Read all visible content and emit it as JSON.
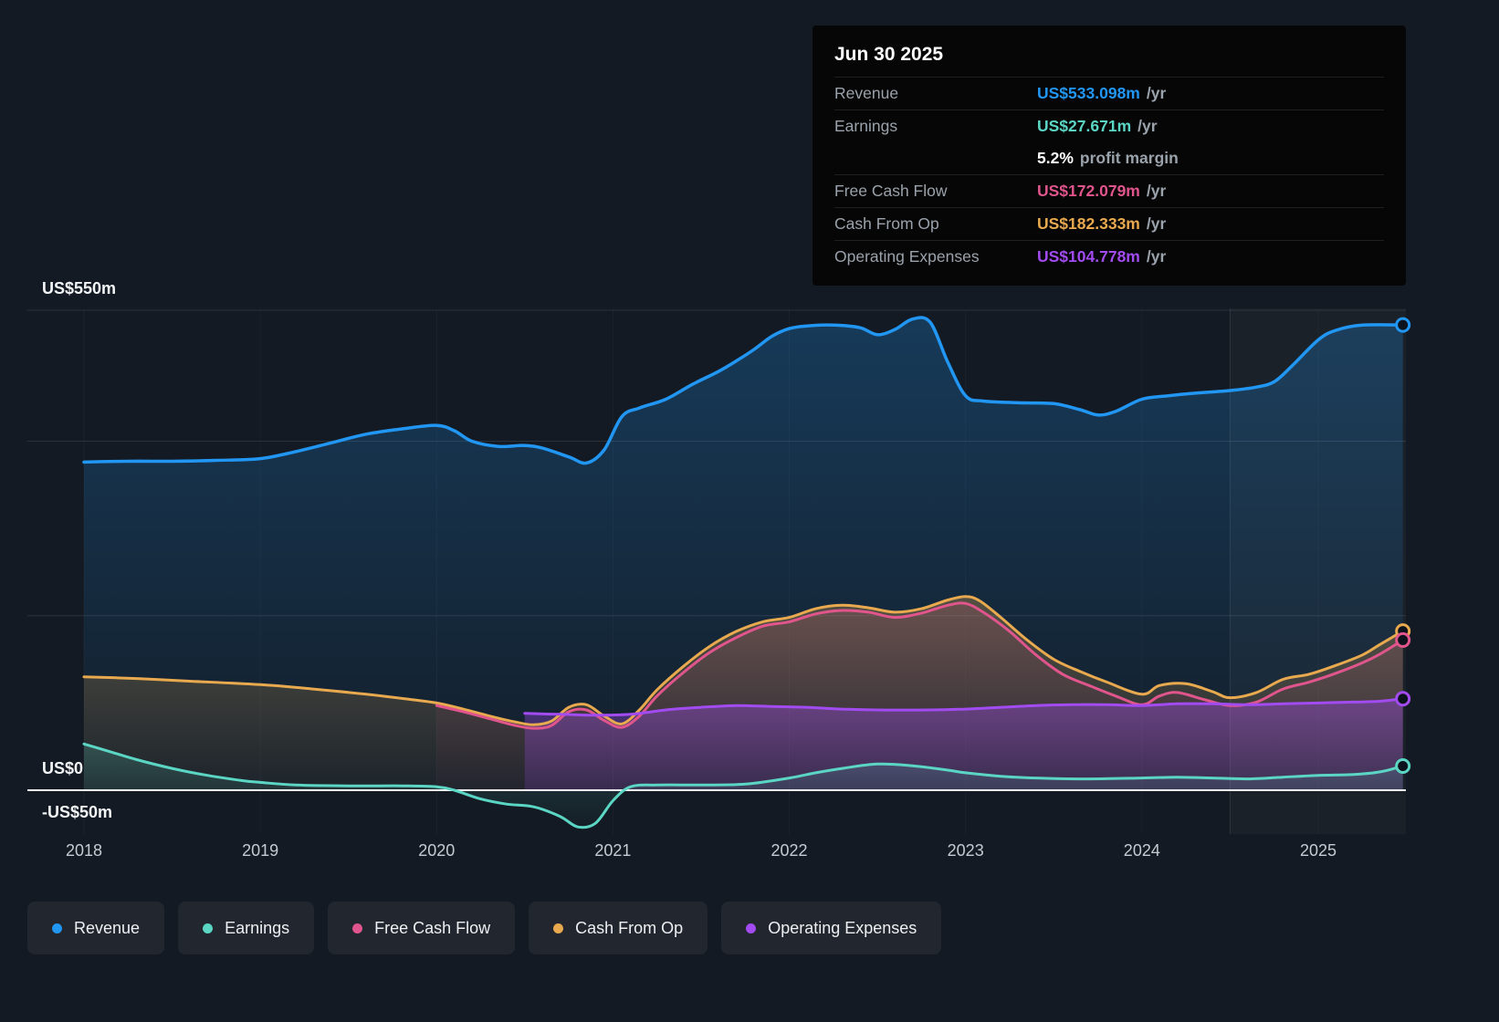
{
  "tooltip": {
    "date": "Jun 30 2025",
    "rows": [
      {
        "label": "Revenue",
        "value": "US$533.098m",
        "suffix": "/yr",
        "color": "#2196F3",
        "divider": true
      },
      {
        "label": "Earnings",
        "value": "US$27.671m",
        "suffix": "/yr",
        "color": "#5CD6C4",
        "divider": true
      },
      {
        "label": "",
        "value": "5.2%",
        "suffix": "profit margin",
        "color": "#FFFFFF",
        "divider": false
      },
      {
        "label": "Free Cash Flow",
        "value": "US$172.079m",
        "suffix": "/yr",
        "color": "#E0558C",
        "divider": true
      },
      {
        "label": "Cash From Op",
        "value": "US$182.333m",
        "suffix": "/yr",
        "color": "#E8A94F",
        "divider": true
      },
      {
        "label": "Operating Expenses",
        "value": "US$104.778m",
        "suffix": "/yr",
        "color": "#A24BF0",
        "divider": true
      }
    ]
  },
  "legend": [
    {
      "label": "Revenue",
      "color": "#2196F3"
    },
    {
      "label": "Earnings",
      "color": "#5CD6C4"
    },
    {
      "label": "Free Cash Flow",
      "color": "#E0558C"
    },
    {
      "label": "Cash From Op",
      "color": "#E8A94F"
    },
    {
      "label": "Operating Expenses",
      "color": "#A24BF0"
    }
  ],
  "chart_data": {
    "type": "area",
    "unit": "US$ millions per year",
    "x_ticks": [
      2018,
      2019,
      2020,
      2021,
      2022,
      2023,
      2024,
      2025
    ],
    "y_axis_labels": [
      {
        "value": 550,
        "text": "US$550m"
      },
      {
        "value": 0,
        "text": "US$0"
      },
      {
        "value": -50,
        "text": "-US$50m"
      }
    ],
    "gridline_values": [
      550,
      400,
      200
    ],
    "zero_line_value": 0,
    "ylim": [
      -50,
      550
    ],
    "xlim": [
      2017.68,
      2025.5
    ],
    "highlight_from": 2024.5,
    "series": [
      {
        "name": "Revenue",
        "color": "#2196F3",
        "points": [
          [
            2018.0,
            376
          ],
          [
            2018.25,
            377
          ],
          [
            2018.5,
            377
          ],
          [
            2018.75,
            378
          ],
          [
            2019.0,
            380
          ],
          [
            2019.2,
            388
          ],
          [
            2019.4,
            398
          ],
          [
            2019.6,
            408
          ],
          [
            2019.8,
            414
          ],
          [
            2020.0,
            418
          ],
          [
            2020.1,
            412
          ],
          [
            2020.2,
            400
          ],
          [
            2020.35,
            394
          ],
          [
            2020.5,
            395
          ],
          [
            2020.6,
            392
          ],
          [
            2020.75,
            382
          ],
          [
            2020.85,
            375
          ],
          [
            2020.95,
            390
          ],
          [
            2021.05,
            428
          ],
          [
            2021.15,
            438
          ],
          [
            2021.3,
            448
          ],
          [
            2021.45,
            465
          ],
          [
            2021.6,
            480
          ],
          [
            2021.7,
            492
          ],
          [
            2021.8,
            505
          ],
          [
            2021.9,
            520
          ],
          [
            2022.0,
            529
          ],
          [
            2022.1,
            532
          ],
          [
            2022.25,
            533
          ],
          [
            2022.4,
            530
          ],
          [
            2022.5,
            522
          ],
          [
            2022.6,
            528
          ],
          [
            2022.7,
            540
          ],
          [
            2022.8,
            536
          ],
          [
            2022.9,
            490
          ],
          [
            2023.0,
            452
          ],
          [
            2023.1,
            446
          ],
          [
            2023.3,
            444
          ],
          [
            2023.5,
            443
          ],
          [
            2023.65,
            436
          ],
          [
            2023.75,
            430
          ],
          [
            2023.85,
            434
          ],
          [
            2024.0,
            448
          ],
          [
            2024.15,
            452
          ],
          [
            2024.3,
            455
          ],
          [
            2024.5,
            458
          ],
          [
            2024.65,
            462
          ],
          [
            2024.75,
            468
          ],
          [
            2024.85,
            486
          ],
          [
            2025.0,
            516
          ],
          [
            2025.1,
            527
          ],
          [
            2025.25,
            533
          ],
          [
            2025.48,
            533.098
          ]
        ]
      },
      {
        "name": "Cash From Op",
        "color": "#E8A94F",
        "points": [
          [
            2018.0,
            130
          ],
          [
            2018.3,
            128
          ],
          [
            2018.6,
            125
          ],
          [
            2019.0,
            121
          ],
          [
            2019.3,
            116
          ],
          [
            2019.6,
            110
          ],
          [
            2019.85,
            104
          ],
          [
            2020.0,
            100
          ],
          [
            2020.15,
            93
          ],
          [
            2020.3,
            85
          ],
          [
            2020.45,
            78
          ],
          [
            2020.55,
            75
          ],
          [
            2020.65,
            79
          ],
          [
            2020.75,
            95
          ],
          [
            2020.85,
            98
          ],
          [
            2020.95,
            85
          ],
          [
            2021.05,
            76
          ],
          [
            2021.15,
            92
          ],
          [
            2021.25,
            115
          ],
          [
            2021.4,
            142
          ],
          [
            2021.55,
            165
          ],
          [
            2021.7,
            182
          ],
          [
            2021.85,
            193
          ],
          [
            2022.0,
            198
          ],
          [
            2022.15,
            208
          ],
          [
            2022.3,
            212
          ],
          [
            2022.45,
            209
          ],
          [
            2022.6,
            204
          ],
          [
            2022.75,
            208
          ],
          [
            2022.9,
            218
          ],
          [
            2023.0,
            222
          ],
          [
            2023.08,
            217
          ],
          [
            2023.2,
            198
          ],
          [
            2023.35,
            172
          ],
          [
            2023.5,
            150
          ],
          [
            2023.65,
            136
          ],
          [
            2023.8,
            124
          ],
          [
            2024.0,
            110
          ],
          [
            2024.1,
            120
          ],
          [
            2024.25,
            122
          ],
          [
            2024.4,
            113
          ],
          [
            2024.5,
            106
          ],
          [
            2024.65,
            112
          ],
          [
            2024.8,
            127
          ],
          [
            2024.95,
            133
          ],
          [
            2025.1,
            143
          ],
          [
            2025.25,
            155
          ],
          [
            2025.35,
            167
          ],
          [
            2025.48,
            182.333
          ]
        ]
      },
      {
        "name": "Free Cash Flow",
        "color": "#E0558C",
        "points": [
          [
            2020.0,
            97
          ],
          [
            2020.15,
            90
          ],
          [
            2020.3,
            82
          ],
          [
            2020.45,
            74
          ],
          [
            2020.55,
            71
          ],
          [
            2020.65,
            74
          ],
          [
            2020.75,
            90
          ],
          [
            2020.85,
            92
          ],
          [
            2020.95,
            80
          ],
          [
            2021.05,
            72
          ],
          [
            2021.15,
            85
          ],
          [
            2021.25,
            108
          ],
          [
            2021.4,
            135
          ],
          [
            2021.55,
            158
          ],
          [
            2021.7,
            175
          ],
          [
            2021.85,
            188
          ],
          [
            2022.0,
            193
          ],
          [
            2022.15,
            202
          ],
          [
            2022.3,
            206
          ],
          [
            2022.45,
            204
          ],
          [
            2022.6,
            198
          ],
          [
            2022.75,
            203
          ],
          [
            2022.9,
            212
          ],
          [
            2023.0,
            214
          ],
          [
            2023.1,
            204
          ],
          [
            2023.25,
            182
          ],
          [
            2023.4,
            155
          ],
          [
            2023.55,
            133
          ],
          [
            2023.7,
            120
          ],
          [
            2023.85,
            108
          ],
          [
            2024.0,
            98
          ],
          [
            2024.1,
            108
          ],
          [
            2024.2,
            112
          ],
          [
            2024.35,
            104
          ],
          [
            2024.5,
            97
          ],
          [
            2024.65,
            101
          ],
          [
            2024.8,
            116
          ],
          [
            2024.95,
            124
          ],
          [
            2025.1,
            134
          ],
          [
            2025.25,
            146
          ],
          [
            2025.35,
            156
          ],
          [
            2025.48,
            172.079
          ]
        ]
      },
      {
        "name": "Operating Expenses",
        "color": "#A24BF0",
        "points": [
          [
            2020.5,
            88
          ],
          [
            2020.7,
            87
          ],
          [
            2020.9,
            86
          ],
          [
            2021.1,
            87
          ],
          [
            2021.3,
            92
          ],
          [
            2021.5,
            95
          ],
          [
            2021.7,
            97
          ],
          [
            2021.9,
            96
          ],
          [
            2022.1,
            95
          ],
          [
            2022.3,
            93
          ],
          [
            2022.5,
            92
          ],
          [
            2022.8,
            92
          ],
          [
            2023.0,
            93
          ],
          [
            2023.2,
            95
          ],
          [
            2023.4,
            97
          ],
          [
            2023.6,
            98
          ],
          [
            2023.8,
            98
          ],
          [
            2024.0,
            97
          ],
          [
            2024.2,
            99
          ],
          [
            2024.4,
            99
          ],
          [
            2024.6,
            98
          ],
          [
            2024.8,
            99
          ],
          [
            2025.0,
            100
          ],
          [
            2025.2,
            101
          ],
          [
            2025.35,
            102
          ],
          [
            2025.48,
            104.778
          ]
        ]
      },
      {
        "name": "Earnings",
        "color": "#5CD6C4",
        "points": [
          [
            2018.0,
            53
          ],
          [
            2018.15,
            44
          ],
          [
            2018.3,
            35
          ],
          [
            2018.5,
            25
          ],
          [
            2018.7,
            17
          ],
          [
            2018.9,
            11
          ],
          [
            2019.0,
            9
          ],
          [
            2019.2,
            6
          ],
          [
            2019.5,
            5
          ],
          [
            2019.8,
            5
          ],
          [
            2020.0,
            4
          ],
          [
            2020.1,
            0
          ],
          [
            2020.25,
            -10
          ],
          [
            2020.4,
            -16
          ],
          [
            2020.55,
            -19
          ],
          [
            2020.7,
            -30
          ],
          [
            2020.8,
            -42
          ],
          [
            2020.9,
            -38
          ],
          [
            2021.0,
            -12
          ],
          [
            2021.1,
            4
          ],
          [
            2021.25,
            6
          ],
          [
            2021.5,
            6
          ],
          [
            2021.75,
            7
          ],
          [
            2022.0,
            14
          ],
          [
            2022.15,
            20
          ],
          [
            2022.3,
            25
          ],
          [
            2022.5,
            30
          ],
          [
            2022.7,
            28
          ],
          [
            2022.9,
            23
          ],
          [
            2023.0,
            20
          ],
          [
            2023.2,
            16
          ],
          [
            2023.4,
            14
          ],
          [
            2023.7,
            13
          ],
          [
            2024.0,
            14
          ],
          [
            2024.2,
            15
          ],
          [
            2024.4,
            14
          ],
          [
            2024.6,
            13
          ],
          [
            2024.8,
            15
          ],
          [
            2025.0,
            17
          ],
          [
            2025.2,
            18
          ],
          [
            2025.35,
            21
          ],
          [
            2025.48,
            27.671
          ]
        ]
      }
    ]
  }
}
